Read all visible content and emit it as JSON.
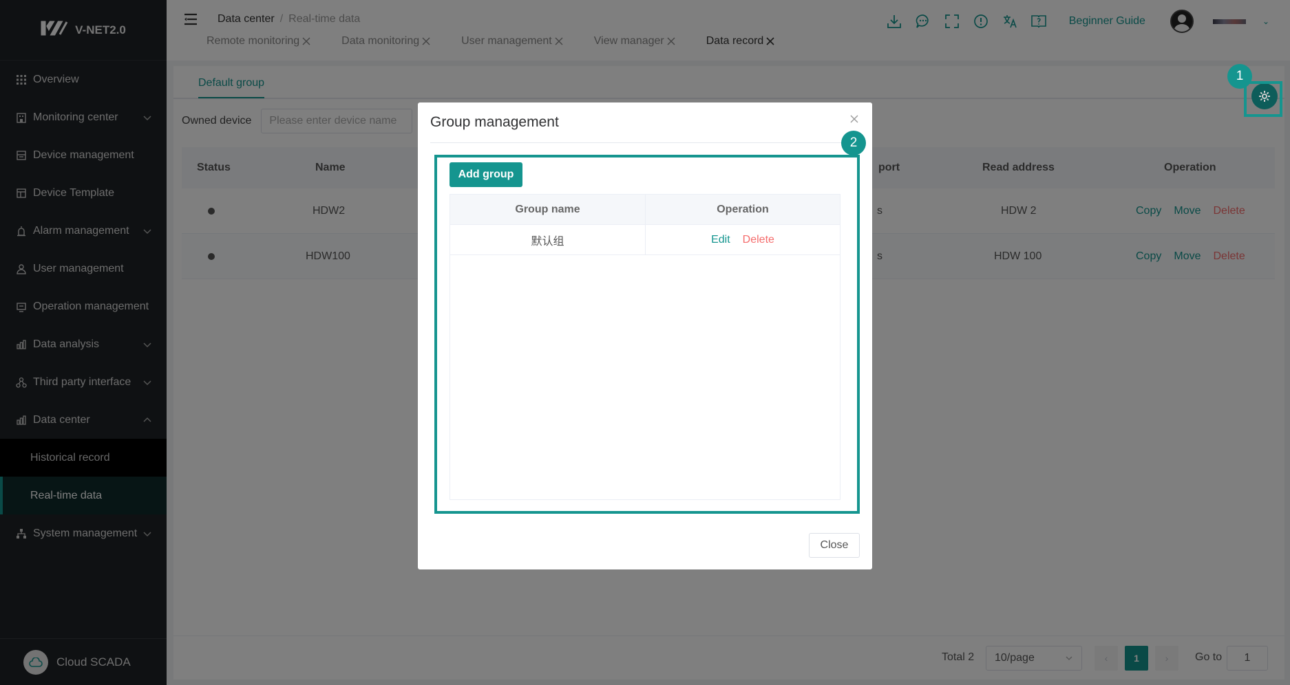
{
  "app": {
    "name": "V-NET2.0",
    "footer": "Cloud SCADA"
  },
  "sidebar": {
    "items": [
      {
        "label": "Overview",
        "icon": "grid-icon"
      },
      {
        "label": "Monitoring center",
        "icon": "building-icon",
        "expandable": true
      },
      {
        "label": "Device management",
        "icon": "device-icon"
      },
      {
        "label": "Device Template",
        "icon": "template-icon"
      },
      {
        "label": "Alarm management",
        "icon": "alarm-icon",
        "expandable": true
      },
      {
        "label": "User management",
        "icon": "user-icon"
      },
      {
        "label": "Operation management",
        "icon": "operation-icon"
      },
      {
        "label": "Data analysis",
        "icon": "chart-icon",
        "expandable": true
      },
      {
        "label": "Third party interface",
        "icon": "interface-icon",
        "expandable": true
      },
      {
        "label": "Data center",
        "icon": "chart-icon",
        "expanded": true
      },
      {
        "label": "System management",
        "icon": "hierarchy-icon",
        "expandable": true
      }
    ],
    "subitems": [
      {
        "label": "Historical record"
      },
      {
        "label": "Real-time data",
        "active": true
      }
    ]
  },
  "header": {
    "breadcrumb": {
      "parent": "Data center",
      "separator": "/",
      "current": "Real-time data"
    },
    "tabs": [
      {
        "label": "Remote monitoring"
      },
      {
        "label": "Data monitoring"
      },
      {
        "label": "User management"
      },
      {
        "label": "View manager"
      },
      {
        "label": "Data record",
        "active": true
      }
    ],
    "guide": "Beginner Guide"
  },
  "main": {
    "group_tab": "Default group",
    "filter": {
      "label": "Owned device",
      "placeholder": "Please enter device name"
    },
    "table": {
      "headers": [
        "Status",
        "Name",
        "port",
        "Read address",
        "Operation"
      ],
      "rows": [
        {
          "name": "HDW2",
          "port": "s",
          "address": "HDW 2"
        },
        {
          "name": "HDW100",
          "port": "s",
          "address": "HDW 100"
        }
      ],
      "ops": {
        "copy": "Copy",
        "move": "Move",
        "delete": "Delete"
      }
    },
    "pager": {
      "total": "Total 2",
      "size": "10/page",
      "page": "1",
      "goto": "Go to",
      "goto_value": "1"
    }
  },
  "badges": {
    "one": "1",
    "two": "2"
  },
  "dialog": {
    "title": "Group management",
    "add_button": "Add group",
    "headers": {
      "name": "Group name",
      "operation": "Operation"
    },
    "rows": [
      {
        "name": "默认组",
        "edit": "Edit",
        "delete": "Delete"
      }
    ],
    "close": "Close"
  },
  "colors": {
    "accent": "#15958f",
    "danger": "#f56c6c",
    "sidebar": "#1f2326"
  }
}
